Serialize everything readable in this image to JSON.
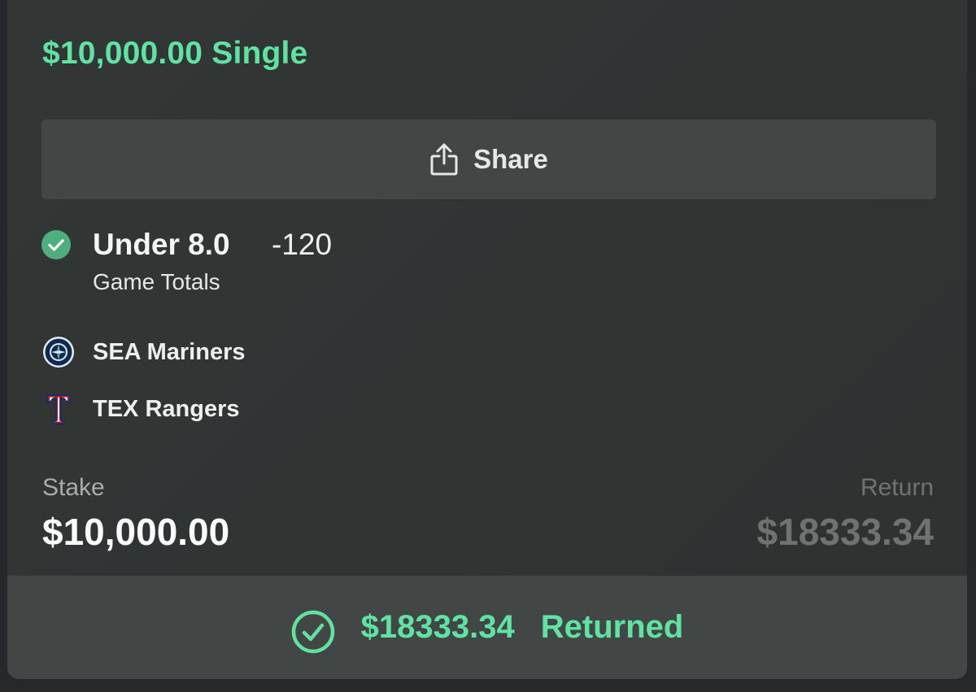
{
  "bet": {
    "title": "$10,000.00 Single"
  },
  "share": {
    "label": "Share",
    "icon": "share-icon"
  },
  "selection": {
    "status_icon": "check-circle-icon",
    "status_color": "#4fae80",
    "name": "Under 8.0",
    "odds": "-120",
    "market": "Game Totals"
  },
  "teams": [
    {
      "name": "SEA Mariners",
      "icon": "mariners-logo-icon"
    },
    {
      "name": "TEX Rangers",
      "icon": "rangers-logo-icon"
    }
  ],
  "stake": {
    "label": "Stake",
    "value": "$10,000.00"
  },
  "return": {
    "label": "Return",
    "value": "$18333.34"
  },
  "result": {
    "icon": "check-circle-outline-icon",
    "amount": "$18333.34",
    "label": "Returned"
  },
  "colors": {
    "accent": "#5fe3a3",
    "card_bg": "#323635",
    "button_bg": "#424645"
  }
}
